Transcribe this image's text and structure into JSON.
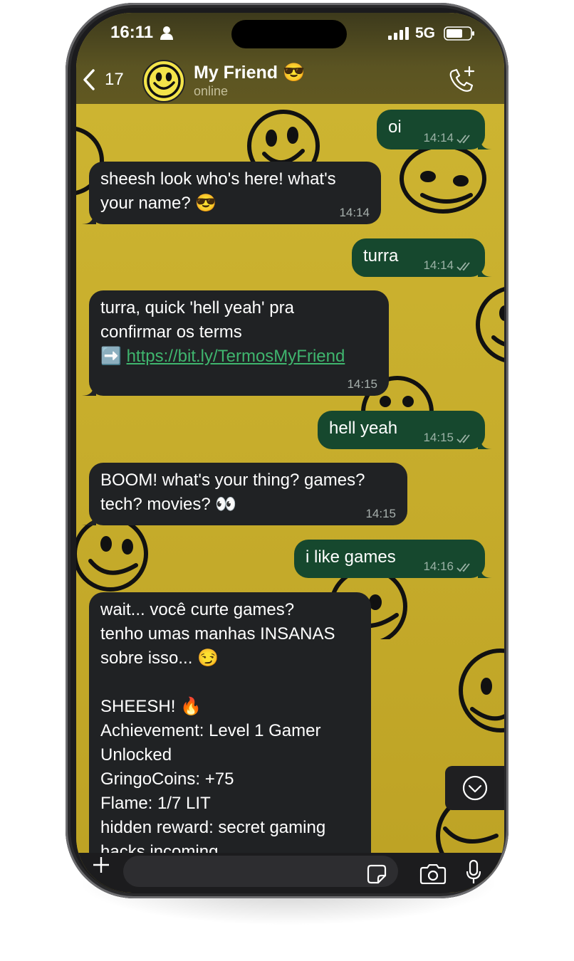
{
  "status_bar": {
    "time": "16:11",
    "network": "5G"
  },
  "header": {
    "unread_count": "17",
    "contact_name": "My Friend 😎",
    "contact_status": "online"
  },
  "messages": [
    {
      "dir": "out",
      "text": "oi",
      "time": "14:14"
    },
    {
      "dir": "in",
      "text": "sheesh look who's here! what's\nyour name? 😎",
      "time": "14:14"
    },
    {
      "dir": "out",
      "text": "turra",
      "time": "14:14"
    },
    {
      "dir": "in",
      "text": "turra, quick 'hell yeah' pra\nconfirmar os terms\n➡️ ",
      "link": "https://bit.ly/TermosMyFriend",
      "time": "14:15"
    },
    {
      "dir": "out",
      "text": "hell yeah",
      "time": "14:15"
    },
    {
      "dir": "in",
      "text": "BOOM! what's your thing? games?\ntech? movies? 👀",
      "time": "14:15"
    },
    {
      "dir": "out",
      "text": "i like games",
      "time": "14:16"
    },
    {
      "dir": "in",
      "text": "wait... você curte games?\ntenho umas manhas INSANAS\nsobre isso... 😏\n\nSHEESH! 🔥\nAchievement: Level 1 Gamer\nUnlocked\nGringoCoins: +75\nFlame: 1/7 LIT\nhidden reward: secret gaming\nhacks incoming"
    }
  ],
  "colors": {
    "wallpaper": "#c9b12e",
    "incoming_bubble": "#202224",
    "outgoing_bubble": "#16482e",
    "link": "#3fb56e"
  },
  "icons": [
    "person-icon",
    "signal-icon",
    "battery-icon",
    "back-icon",
    "add-call-icon",
    "scroll-down-icon",
    "plus-icon",
    "sticker-icon",
    "camera-icon",
    "microphone-icon"
  ]
}
